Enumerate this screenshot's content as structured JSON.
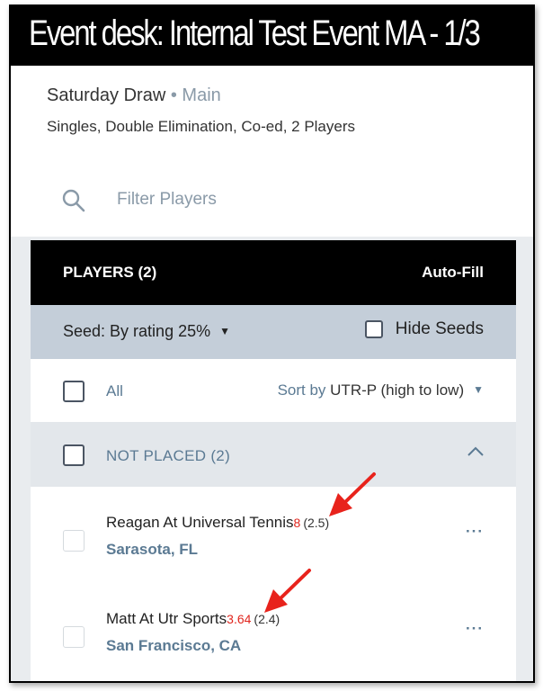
{
  "title": "Event desk: Internal Test Event MA - 1/3",
  "draw": {
    "name": "Saturday Draw",
    "separator": "•",
    "bracket": "Main",
    "details": "Singles, Double Elimination, Co-ed, 2 Players"
  },
  "search": {
    "placeholder": "Filter Players",
    "icon": "search-icon"
  },
  "panel": {
    "title": "PLAYERS (2)",
    "autofill": "Auto-Fill",
    "seed_label": "Seed: By rating 25%",
    "hide_seeds": "Hide Seeds",
    "all_label": "All",
    "sort_by": "Sort by",
    "sort_value": "UTR-P (high to low)",
    "not_placed": "NOT PLACED (2)"
  },
  "players": [
    {
      "name": "Reagan At Universal Tennis",
      "rating": "8",
      "sub_rating": "(2.5)",
      "location": "Sarasota, FL",
      "more": "···"
    },
    {
      "name": "Matt At Utr Sports",
      "rating": "3.64",
      "sub_rating": "(2.4)",
      "location": "San Francisco, CA",
      "more": "···"
    }
  ],
  "colors": {
    "accent": "#5b7a93",
    "rating": "#e0261e",
    "annotation_arrow": "#e8231c",
    "seed_bar": "#c4ced9"
  }
}
